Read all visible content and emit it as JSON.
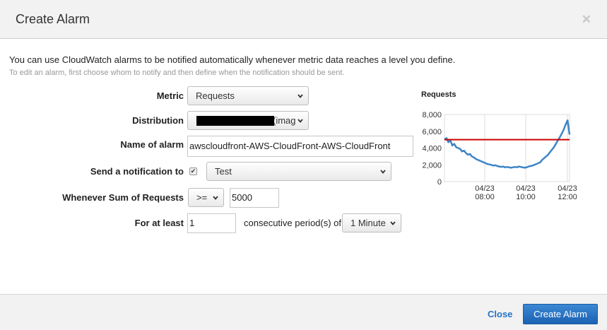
{
  "dialog": {
    "title": "Create Alarm",
    "close_glyph": "✕",
    "intro": "You can use CloudWatch alarms to be notified automatically whenever metric data reaches a level you define.",
    "hint": "To edit an alarm, first choose whom to notify and then define when the notification should be sent."
  },
  "form": {
    "metric_label": "Metric",
    "metric_value": "Requests",
    "distribution_label": "Distribution",
    "distribution_value": "(imag",
    "name_label": "Name of alarm",
    "name_value": "awscloudfront-AWS-CloudFront-AWS-CloudFront",
    "notify_label": "Send a notification to",
    "notify_checked": true,
    "notify_value": "Test",
    "condition_label": "Whenever Sum of Requests",
    "operator_value": ">=",
    "threshold_value": "5000",
    "atleast_label": "For at least",
    "periods_value": "1",
    "consecutive_text": "consecutive period(s) of",
    "period_value": "1 Minute"
  },
  "chart_title": "Requests",
  "chart_data": {
    "type": "line",
    "title": "Requests",
    "ylim": [
      0,
      8000
    ],
    "yticks": [
      "8,000",
      "6,000",
      "4,000",
      "2,000",
      "0"
    ],
    "xticks": [
      {
        "date": "04/23",
        "time": "08:00"
      },
      {
        "date": "04/23",
        "time": "10:00"
      },
      {
        "date": "04/23",
        "time": "12:00"
      }
    ],
    "threshold": 5000,
    "colors": {
      "series": "#3d85c6",
      "threshold": "#cc0000",
      "grid": "#dddddd"
    },
    "series": [
      {
        "values": [
          5000,
          5200,
          4700,
          4900,
          4300,
          4500,
          4100,
          4000,
          3900,
          3600,
          3700,
          3400,
          3200,
          3300,
          3000,
          2900,
          2700,
          2600,
          2500,
          2400,
          2300,
          2200,
          2100,
          2050,
          2000,
          1900,
          1950,
          1850,
          1800,
          1750,
          1800,
          1700,
          1750,
          1700,
          1650,
          1700,
          1750,
          1700,
          1800,
          1750,
          1700,
          1650,
          1700,
          1800,
          1850,
          1900,
          2000,
          2100,
          2200,
          2300,
          2600,
          2800,
          3000,
          3200,
          3500,
          3800,
          4100,
          4500,
          4900,
          5300,
          5700,
          6200,
          6800,
          7300,
          5600
        ]
      }
    ]
  },
  "footer": {
    "close_label": "Close",
    "create_label": "Create Alarm"
  }
}
